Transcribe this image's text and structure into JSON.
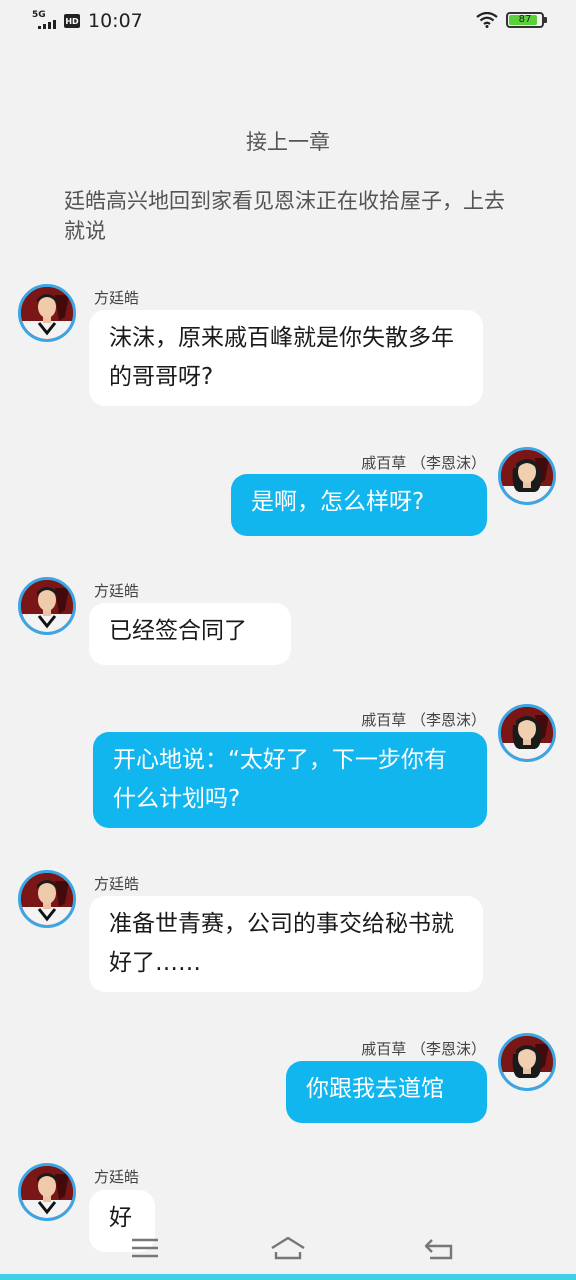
{
  "status_bar": {
    "network": "5G",
    "hd": "HD",
    "time": "10:07",
    "battery": "87",
    "battery_level": 0.87
  },
  "chapter_link": "接上一章",
  "narration": "廷皓高兴地回到家看见恩沫正在收拾屋子，上去就说",
  "messages": [
    {
      "speaker": "方廷皓",
      "text": "沫沫，原来戚百峰就是你失散多年的哥哥呀?"
    },
    {
      "speaker": "戚百草 （李恩沫）",
      "text": "是啊，怎么样呀?"
    },
    {
      "speaker": "方廷皓",
      "text": "已经签合同了"
    },
    {
      "speaker": "戚百草 （李恩沫）",
      "text": "开心地说：“太好了，下一步你有什么计划吗?"
    },
    {
      "speaker": "方廷皓",
      "text": "准备世青赛，公司的事交给秘书就好了……"
    },
    {
      "speaker": "戚百草 （李恩沫）",
      "text": "你跟我去道馆"
    },
    {
      "speaker": "方廷皓",
      "text": "好"
    }
  ],
  "colors": {
    "background": "#f2f2f2",
    "right_bubble": "#12b6ef",
    "left_bubble": "#ffffff",
    "avatar_border": "#3aa6e6"
  },
  "nav_icons": [
    "menu-icon",
    "home-icon",
    "back-icon"
  ]
}
